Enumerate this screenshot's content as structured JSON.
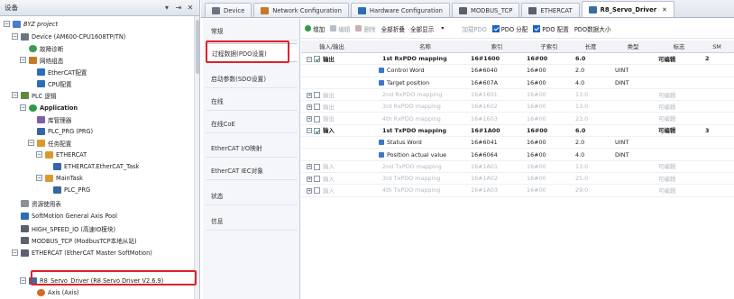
{
  "tree": {
    "title": "设备",
    "pin_glyph": "▾ ⇥",
    "close_glyph": "✕",
    "nodes": [
      {
        "label": "BYZ project",
        "exp": "−",
        "icon": "i-proj",
        "indent": 0,
        "italic": true
      },
      {
        "label": "Device (AM600-CPU1608TP/TN)",
        "exp": "−",
        "icon": "i-dev",
        "indent": 1
      },
      {
        "label": "故障诊断",
        "exp": "",
        "icon": "i-diag",
        "indent": 2
      },
      {
        "label": "网络组态",
        "exp": "−",
        "icon": "i-cfg",
        "indent": 2
      },
      {
        "label": "EtherCAT配置",
        "exp": "",
        "icon": "i-ecat",
        "indent": 3
      },
      {
        "label": "CPU配置",
        "exp": "",
        "icon": "i-cpu",
        "indent": 3
      },
      {
        "label": "PLC 逻辑",
        "exp": "−",
        "icon": "i-plc",
        "indent": 1
      },
      {
        "label": "Application",
        "exp": "−",
        "icon": "i-app",
        "indent": 2,
        "bold": true
      },
      {
        "label": "库管理器",
        "exp": "",
        "icon": "i-lib",
        "indent": 3
      },
      {
        "label": "PLC_PRG (PRG)",
        "exp": "",
        "icon": "i-prg",
        "indent": 3
      },
      {
        "label": "任务配置",
        "exp": "−",
        "icon": "i-task",
        "indent": 3
      },
      {
        "label": "ETHERCAT",
        "exp": "−",
        "icon": "i-task",
        "indent": 4
      },
      {
        "label": "ETHERCAT.EtherCAT_Task",
        "exp": "",
        "icon": "i-prg",
        "indent": 5
      },
      {
        "label": "MainTask",
        "exp": "−",
        "icon": "i-task",
        "indent": 4
      },
      {
        "label": "PLC_PRG",
        "exp": "",
        "icon": "i-prg",
        "indent": 5
      },
      {
        "label": "资源使用表",
        "exp": "",
        "icon": "i-res",
        "indent": 1
      },
      {
        "label": "SoftMotion General Axis Pool",
        "exp": "",
        "icon": "i-soft",
        "indent": 1
      },
      {
        "label": "HIGH_SPEED_IO (高速IO模块)",
        "exp": "",
        "icon": "i-mod",
        "indent": 1
      },
      {
        "label": "MODBUS_TCP (ModbusTCP本地从站)",
        "exp": "",
        "icon": "i-mod",
        "indent": 1
      },
      {
        "label": "ETHERCAT (EtherCAT Master SoftMotion)",
        "exp": "−",
        "icon": "i-mod",
        "indent": 1
      },
      {
        "label": "R8_Servo_Driver (R8 Servo Driver V2.6.9)",
        "exp": "−",
        "icon": "i-servo",
        "indent": 2
      },
      {
        "label": "Axis (Axis)",
        "exp": "",
        "icon": "i-axis",
        "indent": 3
      }
    ]
  },
  "tabs": [
    {
      "label": "Device",
      "icon_color": "#6b7480"
    },
    {
      "label": "Network Configuration",
      "icon_color": "#c47a2a"
    },
    {
      "label": "Hardware Configuration",
      "icon_color": "#2e6cb5"
    },
    {
      "label": "MODBUS_TCP",
      "icon_color": "#5b616b"
    },
    {
      "label": "ETHERCAT",
      "icon_color": "#5b616b"
    },
    {
      "label": "R8_Servo_Driver",
      "icon_color": "#3b6e9c",
      "active": true,
      "close": "✕"
    }
  ],
  "sections": [
    {
      "label": "常规"
    },
    {
      "label": "过程数据(PDO设置)",
      "active": true
    },
    {
      "label": "启动参数(SDO设置)"
    },
    {
      "label": "在线"
    },
    {
      "label": "在线CoE"
    },
    {
      "label": "EtherCAT I/O映射"
    },
    {
      "label": "EtherCAT IEC对象"
    },
    {
      "label": "状态"
    },
    {
      "label": "信息"
    }
  ],
  "toolbar": {
    "add": "增加",
    "edit": "编辑",
    "delete": "删除",
    "collapse_all": "全部折叠",
    "show_all": "全部显示",
    "dropdown_arrow": "▾",
    "load_pdo": "加载PDO",
    "pdo_assign": "PDO 分配",
    "pdo_config": "PDO 配置",
    "pdo_size": "PDO数据大小",
    "side_text": "输\n输"
  },
  "table": {
    "headers": [
      "输入/输出",
      "名称",
      "索引",
      "子索引",
      "长度",
      "类型",
      "标志",
      "SM"
    ],
    "rows": [
      {
        "exp": "−",
        "check": true,
        "io": "输出",
        "name": "1st RxPDO mapping",
        "index": "16#1600",
        "sub": "16#00",
        "len": "6.0",
        "type": "",
        "flag": "可编辑",
        "sm": "2",
        "style": "bold"
      },
      {
        "sub_row": true,
        "name": "Control Word",
        "index": "16#6040",
        "sub": "16#00",
        "len": "2.0",
        "type": "UINT",
        "flag": "",
        "sm": "",
        "style": ""
      },
      {
        "sub_row": true,
        "name": "Target position",
        "index": "16#607A",
        "sub": "16#00",
        "len": "4.0",
        "type": "DINT",
        "flag": "",
        "sm": "",
        "style": ""
      },
      {
        "exp": "+",
        "check": false,
        "io": "输出",
        "name": "2nd RxPDO mapping",
        "index": "16#1601",
        "sub": "16#00",
        "len": "13.0",
        "type": "",
        "flag": "可编辑",
        "sm": "",
        "style": "dim"
      },
      {
        "exp": "+",
        "check": false,
        "io": "输出",
        "name": "3rd RxPDO mapping",
        "index": "16#1602",
        "sub": "16#00",
        "len": "13.0",
        "type": "",
        "flag": "可编辑",
        "sm": "",
        "style": "dim"
      },
      {
        "exp": "+",
        "check": false,
        "io": "输出",
        "name": "4th RxPDO mapping",
        "index": "16#1603",
        "sub": "16#00",
        "len": "23.0",
        "type": "",
        "flag": "可编辑",
        "sm": "",
        "style": "dim"
      },
      {
        "exp": "−",
        "check": true,
        "io": "输入",
        "name": "1st TxPDO mapping",
        "index": "16#1A00",
        "sub": "16#00",
        "len": "6.0",
        "type": "",
        "flag": "可编辑",
        "sm": "3",
        "style": "bold"
      },
      {
        "sub_row": true,
        "name": "Status Word",
        "index": "16#6041",
        "sub": "16#00",
        "len": "2.0",
        "type": "UINT",
        "flag": "",
        "sm": "",
        "style": ""
      },
      {
        "sub_row": true,
        "name": "Position actual value",
        "index": "16#6064",
        "sub": "16#00",
        "len": "4.0",
        "type": "DINT",
        "flag": "",
        "sm": "",
        "style": ""
      },
      {
        "exp": "+",
        "check": false,
        "io": "输入",
        "name": "2nd TxPDO mapping",
        "index": "16#1A01",
        "sub": "16#00",
        "len": "13.0",
        "type": "",
        "flag": "可编辑",
        "sm": "",
        "style": "dim"
      },
      {
        "exp": "+",
        "check": false,
        "io": "输入",
        "name": "3rd TxPDO mapping",
        "index": "16#1A02",
        "sub": "16#00",
        "len": "25.0",
        "type": "",
        "flag": "可编辑",
        "sm": "",
        "style": "dim"
      },
      {
        "exp": "+",
        "check": false,
        "io": "输入",
        "name": "4th TxPDO mapping",
        "index": "16#1A03",
        "sub": "16#00",
        "len": "29.0",
        "type": "",
        "flag": "可编辑",
        "sm": "",
        "style": "dim"
      }
    ]
  },
  "colors": {
    "highlight": "#e0222a",
    "accent": "#1b62c8"
  }
}
